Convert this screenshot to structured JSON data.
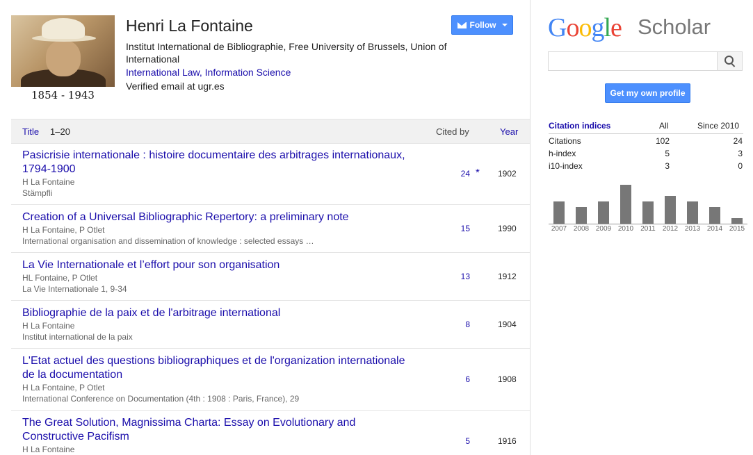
{
  "profile": {
    "life_years": "1854 - 1943",
    "name": "Henri La Fontaine",
    "affiliation": "Institut International de Bibliographie, Free University of Brussels, Union of International",
    "interests": [
      "International Law",
      "Information Science"
    ],
    "interest_sep": ", ",
    "email": "Verified email at ugr.es",
    "follow_label": "Follow"
  },
  "table": {
    "col_title": "Title",
    "range": "1–20",
    "col_cited": "Cited by",
    "col_year": "Year",
    "rows": [
      {
        "title": "Pasicrisie internationale : histoire documentaire des arbitrages internationaux, 1794-1900",
        "authors": "H La Fontaine",
        "venue": "Stämpfli",
        "cites": "24",
        "star": "*",
        "year": "1902"
      },
      {
        "title": "Creation of a Universal Bibliographic Repertory: a preliminary note",
        "authors": "H La Fontaine, P Otlet",
        "venue": "International organisation and dissemination of knowledge : selected essays …",
        "cites": "15",
        "star": "",
        "year": "1990"
      },
      {
        "title": "La Vie Internationale et l’effort pour son organisation",
        "authors": "HL Fontaine, P Otlet",
        "venue": "La Vie Internationale 1, 9-34",
        "cites": "13",
        "star": "",
        "year": "1912"
      },
      {
        "title": "Bibliographie de la paix et de l'arbitrage international",
        "authors": "H La Fontaine",
        "venue": "Institut international de la paix",
        "cites": "8",
        "star": "",
        "year": "1904"
      },
      {
        "title": "L'Etat actuel des questions bibliographiques et de l'organization internationale de la documentation",
        "authors": "H La Fontaine, P Otlet",
        "venue": "International Conference on Documentation (4th : 1908 : Paris, France), 29",
        "cites": "6",
        "star": "",
        "year": "1908"
      },
      {
        "title": "The Great Solution, Magnissima Charta: Essay on Evolutionary and Constructive Pacifism",
        "authors": "H La Fontaine",
        "venue": "",
        "cites": "5",
        "star": "",
        "year": "1916"
      }
    ]
  },
  "sidebar": {
    "logo_letters": [
      "G",
      "o",
      "o",
      "g",
      "l",
      "e"
    ],
    "logo_product": "Scholar",
    "get_profile_label": "Get my own profile",
    "citation_indices": {
      "heading": "Citation indices",
      "col_all": "All",
      "col_since": "Since 2010",
      "rows": [
        {
          "label": "Citations",
          "all": "102",
          "since": "24"
        },
        {
          "label": "h-index",
          "all": "5",
          "since": "3"
        },
        {
          "label": "i10-index",
          "all": "3",
          "since": "0"
        }
      ]
    }
  },
  "chart_data": {
    "type": "bar",
    "title": "",
    "categories": [
      "2007",
      "2008",
      "2009",
      "2010",
      "2011",
      "2012",
      "2013",
      "2014",
      "2015"
    ],
    "values": [
      4,
      3,
      4,
      7,
      4,
      5,
      4,
      3,
      1
    ],
    "color": "#777777"
  }
}
